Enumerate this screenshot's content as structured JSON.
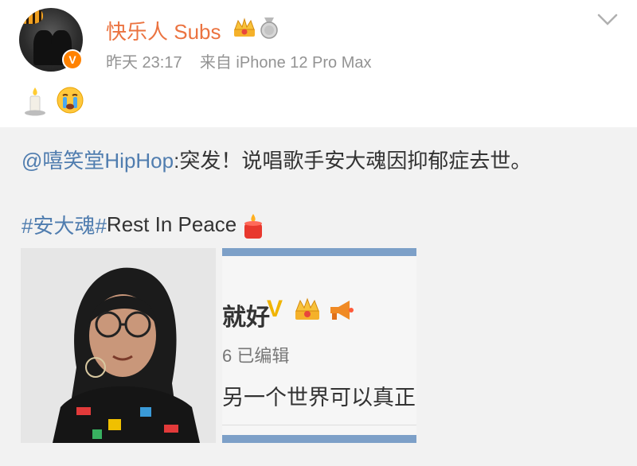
{
  "post": {
    "username": "快乐人 Subs",
    "timestamp": "昨天 23:17",
    "source": "来自 iPhone 12 Pro Max",
    "verified_badge": "V",
    "icons": [
      "crown-badge-icon",
      "medal-badge-icon",
      "chevron-down-icon"
    ],
    "body_emojis": [
      "candle-emoji-icon",
      "crying-face-emoji-icon"
    ]
  },
  "repost": {
    "mention": "@嘻笑堂HipHop",
    "text": ":突发！说唱歌手安大魂因抑郁症去世。",
    "hashtag": "#安大魂#",
    "hashtag_tail": " Rest In Peace"
  },
  "images": {
    "second": {
      "name_fragment": "就好",
      "v": "V",
      "time_fragment": "6  已编辑",
      "text_fragment": "另一个世界可以真正",
      "watermark": "◎@"
    }
  },
  "colors": {
    "username": "#eb7340",
    "link": "#507daf",
    "meta": "#939393",
    "repost_bg": "#f2f2f2"
  }
}
